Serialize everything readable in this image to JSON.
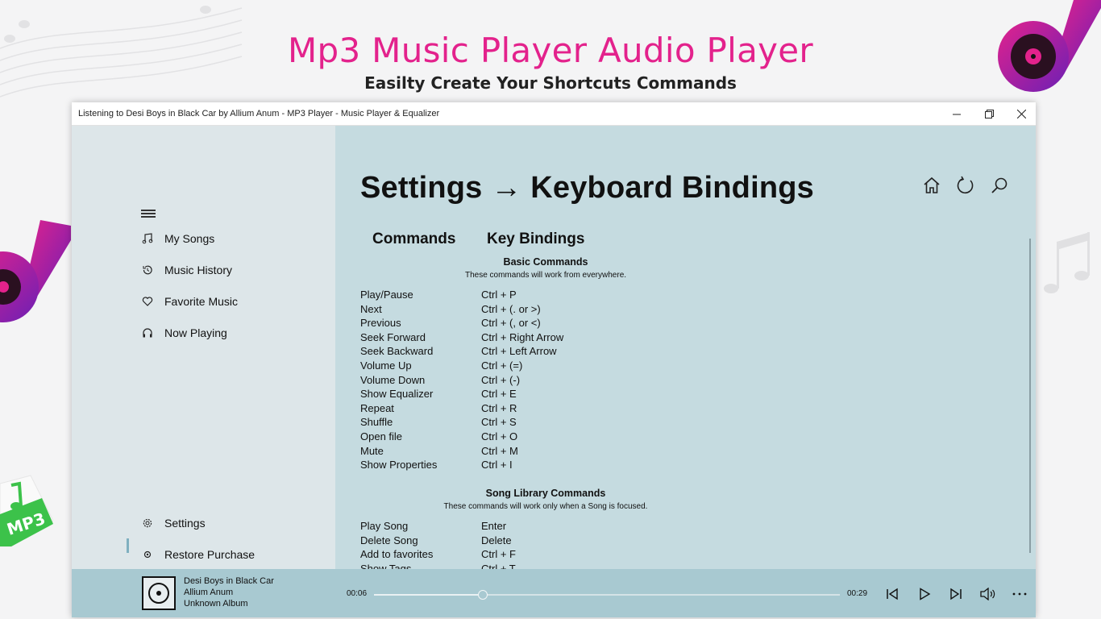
{
  "promo": {
    "title": "Mp3 Music Player Audio Player",
    "subtitle": "Easilty Create Your Shortcuts Commands",
    "badge": "MP3",
    "accent_color": "#e3228c"
  },
  "window": {
    "title": "Listening to Desi Boys in Black Car by Allium Anum - MP3 Player - Music Player & Equalizer",
    "controls": [
      "minimize-icon",
      "restore-icon",
      "close-icon"
    ]
  },
  "sidebar": {
    "menu_icon": "hamburger-icon",
    "items": [
      {
        "label": "My Songs",
        "icon": "music-note-icon"
      },
      {
        "label": "Music History",
        "icon": "history-icon"
      },
      {
        "label": "Favorite Music",
        "icon": "heart-icon"
      },
      {
        "label": "Now Playing",
        "icon": "headphones-icon"
      }
    ],
    "bottom_items": [
      {
        "label": "Settings",
        "icon": "gear-icon",
        "active": true
      },
      {
        "label": "Restore Purchase",
        "icon": "restore-icon"
      }
    ]
  },
  "main": {
    "title": "Settings → Keyboard Bindings",
    "header_icons": [
      "home-icon",
      "refresh-icon",
      "search-icon"
    ],
    "columns": {
      "commands": "Commands",
      "bindings": "Key Bindings"
    },
    "basic": {
      "title": "Basic Commands",
      "subtitle": "These commands will work from everywhere.",
      "rows": [
        {
          "command": "Play/Pause",
          "key": "Ctrl + P"
        },
        {
          "command": "Next",
          "key": "Ctrl + (. or >)"
        },
        {
          "command": "Previous",
          "key": "Ctrl + (, or <)"
        },
        {
          "command": "Seek Forward",
          "key": "Ctrl + Right Arrow"
        },
        {
          "command": "Seek Backward",
          "key": "Ctrl + Left Arrow"
        },
        {
          "command": "Volume Up",
          "key": "Ctrl + (=)"
        },
        {
          "command": "Volume Down",
          "key": "Ctrl + (-)"
        },
        {
          "command": "Show Equalizer",
          "key": "Ctrl + E"
        },
        {
          "command": "Repeat",
          "key": "Ctrl + R"
        },
        {
          "command": "Shuffle",
          "key": "Ctrl + S"
        },
        {
          "command": "Open file",
          "key": "Ctrl + O"
        },
        {
          "command": "Mute",
          "key": "Ctrl + M"
        },
        {
          "command": "Show Properties",
          "key": "Ctrl + I"
        }
      ]
    },
    "library": {
      "title": "Song Library Commands",
      "subtitle": "These commands will work only when a Song is focused.",
      "rows": [
        {
          "command": "Play Song",
          "key": "Enter"
        },
        {
          "command": "Delete Song",
          "key": "Delete"
        },
        {
          "command": "Add to favorites",
          "key": "Ctrl + F"
        },
        {
          "command": "Show Tags",
          "key": "Ctrl + T"
        }
      ]
    }
  },
  "player": {
    "song": "Desi Boys in Black Car",
    "artist": "Allium Anum",
    "album": "Unknown Album",
    "elapsed": "00:06",
    "remaining": "00:29",
    "progress": 0.233,
    "buttons": [
      "previous-icon",
      "play-icon",
      "next-icon",
      "volume-icon",
      "more-icon"
    ]
  }
}
